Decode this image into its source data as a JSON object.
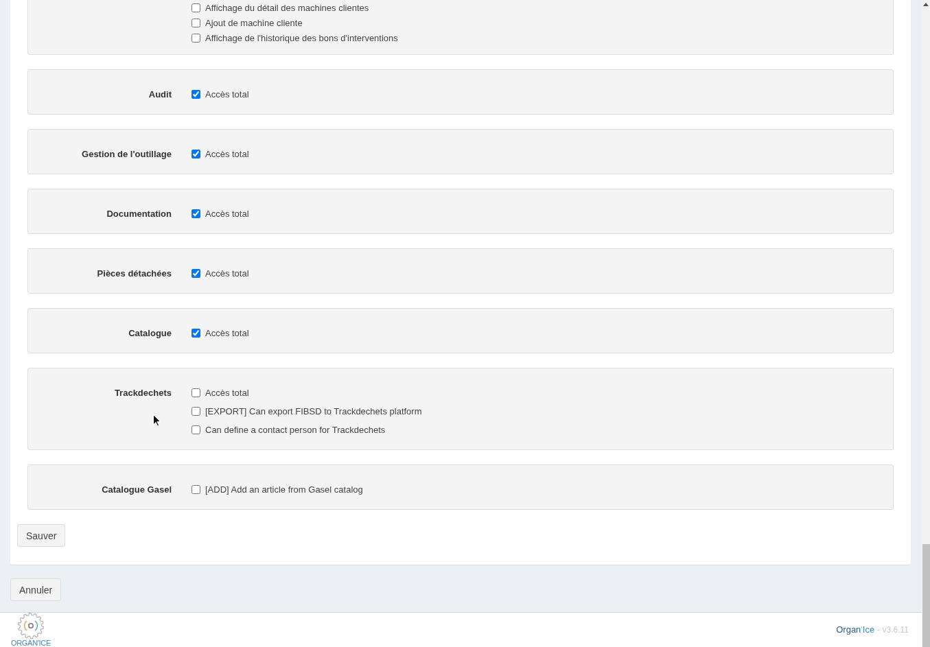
{
  "permission_groups": [
    {
      "permissions": [
        {
          "label": "Affichage du détail des machines clientes",
          "checked": false
        },
        {
          "label": "Ajout de machine cliente",
          "checked": false
        },
        {
          "label": "Affichage de l'historique des bons d'interventions",
          "checked": false
        }
      ]
    },
    {
      "name": "Audit",
      "permissions": [
        {
          "label": "Accès total",
          "checked": true
        }
      ]
    },
    {
      "name": "Gestion de l'outillage",
      "permissions": [
        {
          "label": "Accès total",
          "checked": true
        }
      ]
    },
    {
      "name": "Documentation",
      "permissions": [
        {
          "label": "Accès total",
          "checked": true
        }
      ]
    },
    {
      "name": "Pièces détachées",
      "permissions": [
        {
          "label": "Accès total",
          "checked": true
        }
      ]
    },
    {
      "name": "Catalogue",
      "permissions": [
        {
          "label": "Accès total",
          "checked": true
        }
      ]
    },
    {
      "name": "Trackdechets",
      "permissions": [
        {
          "label": "Accès total",
          "checked": false
        },
        {
          "label": "[EXPORT] Can export FIBSD to Trackdechets platform",
          "checked": false
        },
        {
          "label": "Can define a contact person for Trackdechets",
          "checked": false
        }
      ]
    },
    {
      "name": "Catalogue Gasel",
      "permissions": [
        {
          "label": "[ADD] Add an article from Gasel catalog",
          "checked": false
        }
      ]
    }
  ],
  "buttons": {
    "save": "Sauver",
    "cancel": "Annuler"
  },
  "footer": {
    "logo_text": "ORGAN'ICE",
    "brand": [
      "Organ",
      "'",
      "Ice"
    ],
    "version": "- v3.6.11"
  }
}
